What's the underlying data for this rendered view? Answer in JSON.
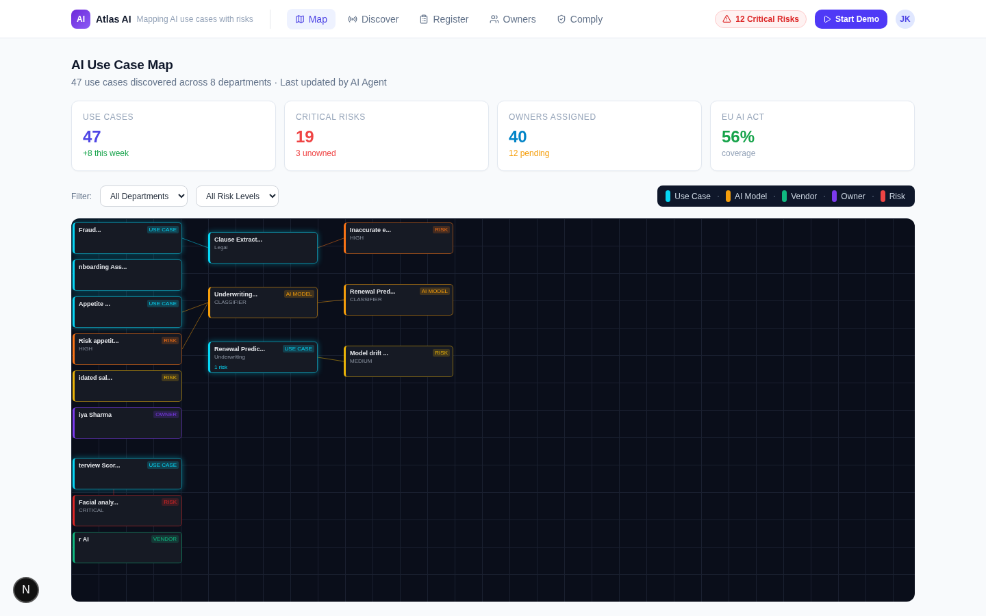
{
  "brand": {
    "logo": "AI",
    "name": "Atlas AI",
    "tagline": "Mapping AI use cases with risks"
  },
  "nav": [
    {
      "label": "Map",
      "selected": true
    },
    {
      "label": "Discover",
      "selected": false
    },
    {
      "label": "Register",
      "selected": false
    },
    {
      "label": "Owners",
      "selected": false
    },
    {
      "label": "Comply",
      "selected": false
    }
  ],
  "alert": "12 Critical Risks",
  "demo_button": "Start Demo",
  "avatar": "JK",
  "page": {
    "title": "AI Use Case Map",
    "subtitle": "47 use cases discovered across 8 departments · Last updated by AI Agent"
  },
  "stats": [
    {
      "label": "USE CASES",
      "value": {
        "text": "47",
        "color": "#4f46e5"
      },
      "note": {
        "text": "+8 this week",
        "color": "#16a34a"
      }
    },
    {
      "label": "CRITICAL RISKS",
      "value": {
        "text": "19",
        "color": "#ef4444"
      },
      "note": {
        "text": "3 unowned",
        "color": "#ef4444"
      }
    },
    {
      "label": "OWNERS ASSIGNED",
      "value": {
        "text": "40",
        "color": "#0284c7"
      },
      "note": {
        "text": "12 pending",
        "color": "#f59e0b"
      }
    },
    {
      "label": "EU AI ACT",
      "value": {
        "text": "56%",
        "color": "#16a34a"
      },
      "note": {
        "text": "coverage",
        "color": "#94a3b8"
      }
    }
  ],
  "filter": {
    "label": "Filter:",
    "selects": [
      {
        "value": "All Departments"
      },
      {
        "value": "All Risk Levels"
      }
    ]
  },
  "legend": [
    {
      "label": "Use Case",
      "color": "#06d6f5"
    },
    {
      "label": "AI Model",
      "color": "#f59e0b"
    },
    {
      "label": "Vendor",
      "color": "#10b981"
    },
    {
      "label": "Owner",
      "color": "#7c3aed"
    },
    {
      "label": "Risk",
      "color": "#ef4444"
    }
  ],
  "map": {
    "nodes": [
      {
        "kind": "usecase",
        "title": "Fraud...",
        "badge": "USE CASE"
      },
      {
        "kind": "usecase",
        "title": "nboarding Ass..."
      },
      {
        "kind": "usecase",
        "title": "Appetite ...",
        "badge": "USE CASE"
      },
      {
        "kind": "risk",
        "title": "Risk appetit...",
        "subtitle": "HIGH",
        "badge": "RISK"
      },
      {
        "kind": "warn",
        "title": "idated sal...",
        "badge": "RISK"
      },
      {
        "kind": "owner",
        "title": "iya Sharma",
        "badge": "OWNER"
      },
      {
        "kind": "usecase",
        "title": "terview Scor...",
        "badge": "USE CASE"
      },
      {
        "kind": "critical",
        "title": "Facial analy...",
        "subtitle": "CRITICAL",
        "badge": "RISK"
      },
      {
        "kind": "vendor",
        "title": "r AI",
        "badge": "VENDOR"
      },
      {
        "kind": "usecase",
        "title": "Clause Extract...",
        "subtitle": "Legal"
      },
      {
        "kind": "model",
        "title": "Underwriting...",
        "subtitle": "CLASSIFIER",
        "badge": "AI MODEL"
      },
      {
        "kind": "usecase",
        "title": "Renewal Predic...",
        "subtitle": "Underwriting",
        "badge": "USE CASE",
        "footer": "1 risk"
      },
      {
        "kind": "risk",
        "title": "Inaccurate e...",
        "subtitle": "HIGH",
        "badge": "RISK"
      },
      {
        "kind": "model",
        "title": "Renewal Pred...",
        "subtitle": "CLASSIFIER",
        "badge": "AI MODEL"
      },
      {
        "kind": "warn",
        "title": "Model drift ...",
        "subtitle": "MEDIUM",
        "badge": "RISK"
      }
    ]
  },
  "dev_badge": "N"
}
